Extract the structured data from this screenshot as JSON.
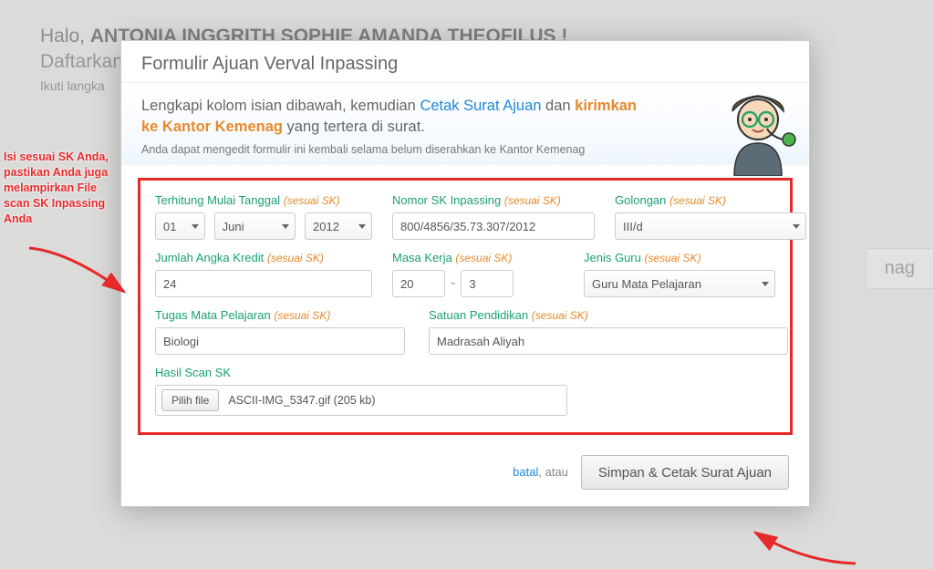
{
  "background": {
    "halo": "Halo,",
    "name": "ANTONIA INGGRITH SOPHIE AMANDA THEOFILUS !",
    "daftarkan": "Daftarkan",
    "ikuti": "Ikuti langka",
    "tag": "nag"
  },
  "modal": {
    "title": "Formulir Ajuan Verval Inpassing",
    "intro_a": "Lengkapi kolom isian dibawah, kemudian ",
    "intro_link1": "Cetak Surat Ajuan",
    "intro_b": " dan ",
    "intro_link2": "kirimkan ke Kantor Kemenag",
    "intro_c": " yang tertera di surat.",
    "intro_sub": "Anda dapat mengedit formulir ini kembali selama belum diserahkan ke Kantor Kemenag"
  },
  "labels": {
    "tmt": "Terhitung Mulai Tanggal",
    "nomor_sk": "Nomor SK Inpassing",
    "golongan": "Golongan",
    "jumlah_angka_kredit": "Jumlah Angka Kredit",
    "masa_kerja": "Masa Kerja",
    "jenis_guru": "Jenis Guru",
    "tugas_mapel": "Tugas Mata Pelajaran",
    "satuan_pendidikan": "Satuan Pendidikan",
    "hasil_scan": "Hasil Scan SK",
    "hint": "(sesuai SK)"
  },
  "values": {
    "day": "01",
    "month": "Juni",
    "year": "2012",
    "nomor_sk": "800/4856/35.73.307/2012",
    "golongan": "III/d",
    "angka_kredit": "24",
    "masa_a": "20",
    "masa_b": "3",
    "jenis_guru": "Guru Mata Pelajaran",
    "tugas_mapel": "Biologi",
    "satuan_pendidikan": "Madrasah Aliyah",
    "file_button": "Pilih file",
    "file_name": "ASCII-IMG_5347.gif (205 kb)"
  },
  "footer": {
    "batal": "batal",
    "atau": ", atau",
    "simpan": "Simpan & Cetak Surat Ajuan"
  },
  "annotation": {
    "text": "Isi sesuai SK Anda, pastikan Anda juga melampirkan File scan SK Inpassing Anda"
  }
}
